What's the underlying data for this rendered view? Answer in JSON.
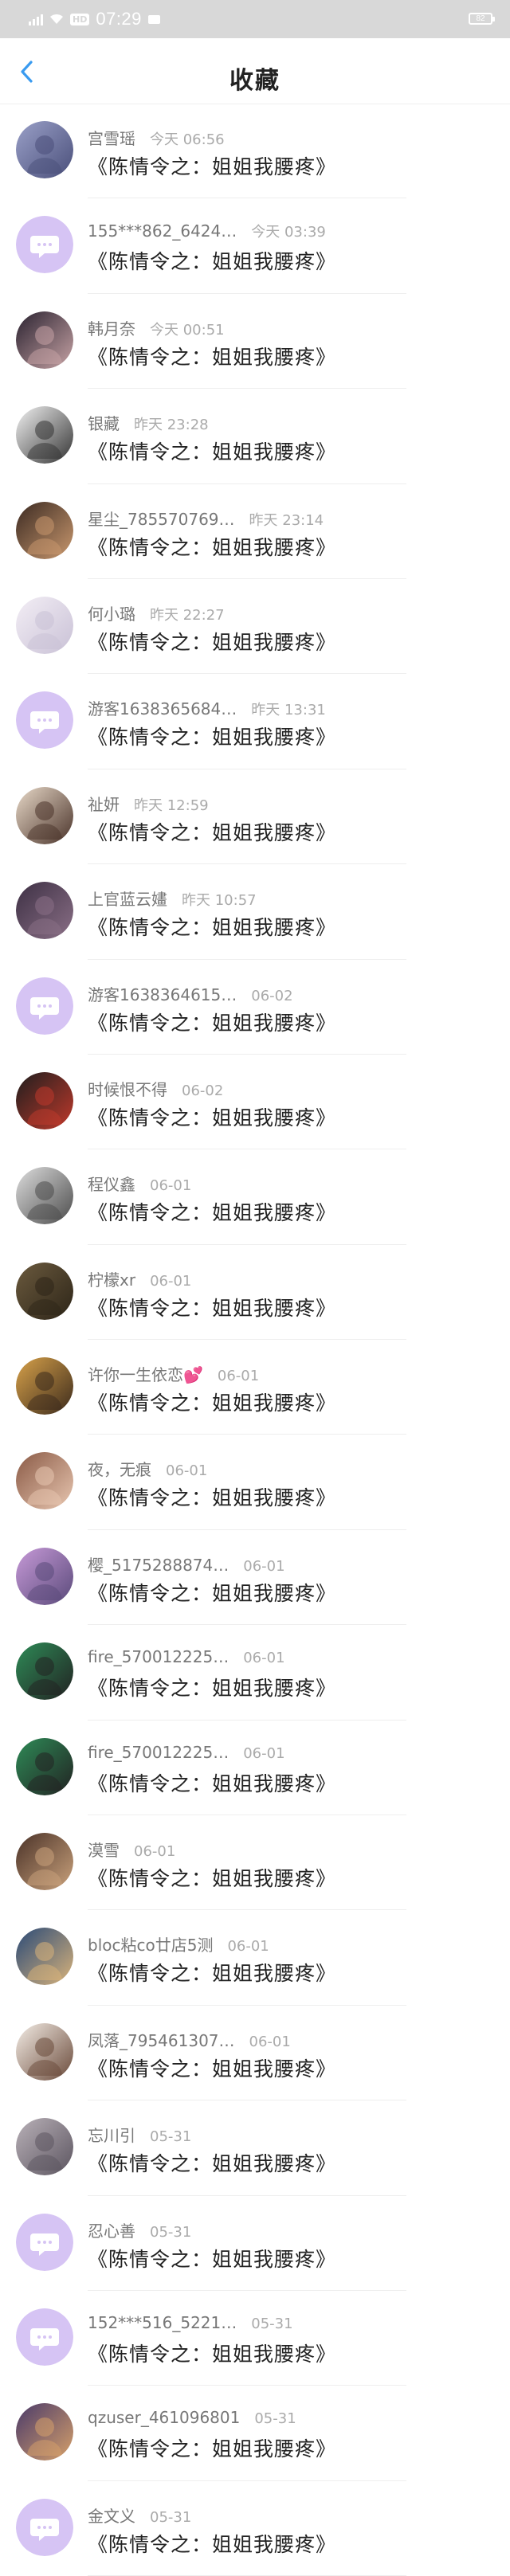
{
  "status_bar": {
    "time": "07:29",
    "network": "HD",
    "battery": "82"
  },
  "header": {
    "title": "收藏",
    "back_icon": "chevron-left-icon"
  },
  "colors": {
    "accent": "#3a9bf0",
    "default_avatar": "#d6c4f4",
    "default_avatar_icon": "#ffffff"
  },
  "items": [
    {
      "user": "宫雪瑶",
      "time": "今天 06:56",
      "content": "《陈情令之：姐姐我腰疼》",
      "avatar": "photo",
      "palette": [
        "#9aa0c8",
        "#4a4f7a"
      ]
    },
    {
      "user": "155***862_6424…",
      "time": "今天 03:39",
      "content": "《陈情令之：姐姐我腰疼》",
      "avatar": "default",
      "palette": [
        "#d6c4f4",
        "#ffffff"
      ]
    },
    {
      "user": "韩月奈",
      "time": "今天 00:51",
      "content": "《陈情令之：姐姐我腰疼》",
      "avatar": "photo",
      "palette": [
        "#2a2230",
        "#c7a3a5"
      ]
    },
    {
      "user": "银藏",
      "time": "昨天 23:28",
      "content": "《陈情令之：姐姐我腰疼》",
      "avatar": "photo",
      "palette": [
        "#f2f2f2",
        "#333333"
      ]
    },
    {
      "user": "星尘_785570769…",
      "time": "昨天 23:14",
      "content": "《陈情令之：姐姐我腰疼》",
      "avatar": "photo",
      "palette": [
        "#3b2a22",
        "#c9986e"
      ]
    },
    {
      "user": "何小璐",
      "time": "昨天 22:27",
      "content": "《陈情令之：姐姐我腰疼》",
      "avatar": "photo",
      "palette": [
        "#f3eef5",
        "#c9c1d6"
      ]
    },
    {
      "user": "游客1638365684…",
      "time": "昨天 13:31",
      "content": "《陈情令之：姐姐我腰疼》",
      "avatar": "default",
      "palette": [
        "#d6c4f4",
        "#ffffff"
      ]
    },
    {
      "user": "祉妍",
      "time": "昨天 12:59",
      "content": "《陈情令之：姐姐我腰疼》",
      "avatar": "photo",
      "palette": [
        "#e8d9c8",
        "#4a332a"
      ]
    },
    {
      "user": "上官蓝云嫿",
      "time": "昨天 10:57",
      "content": "《陈情令之：姐姐我腰疼》",
      "avatar": "photo",
      "palette": [
        "#3d3044",
        "#8a6f86"
      ]
    },
    {
      "user": "游客1638364615…",
      "time": "06-02",
      "content": "《陈情令之：姐姐我腰疼》",
      "avatar": "default",
      "palette": [
        "#d6c4f4",
        "#ffffff"
      ]
    },
    {
      "user": "时候恨不得",
      "time": "06-02",
      "content": "《陈情令之：姐姐我腰疼》",
      "avatar": "photo",
      "palette": [
        "#1e1e1e",
        "#c0392b"
      ]
    },
    {
      "user": "程仪鑫",
      "time": "06-01",
      "content": "《陈情令之：姐姐我腰疼》",
      "avatar": "photo",
      "palette": [
        "#dedede",
        "#4b4b4b"
      ]
    },
    {
      "user": "柠檬xr",
      "time": "06-01",
      "content": "《陈情令之：姐姐我腰疼》",
      "avatar": "photo",
      "palette": [
        "#6b5a3e",
        "#2d2518"
      ]
    },
    {
      "user": "许你一生依恋💕",
      "time": "06-01",
      "content": "《陈情令之：姐姐我腰疼》",
      "avatar": "photo",
      "palette": [
        "#d8a24a",
        "#3b2a1c"
      ]
    },
    {
      "user": "夜，无痕",
      "time": "06-01",
      "content": "《陈情令之：姐姐我腰疼》",
      "avatar": "photo",
      "palette": [
        "#8a5a46",
        "#e8c6b0"
      ]
    },
    {
      "user": "樱_5175288874…",
      "time": "06-01",
      "content": "《陈情令之：姐姐我腰疼》",
      "avatar": "photo",
      "palette": [
        "#c79ad8",
        "#5a4a7a"
      ]
    },
    {
      "user": "fire_570012225…",
      "time": "06-01",
      "content": "《陈情令之：姐姐我腰疼》",
      "avatar": "photo",
      "palette": [
        "#2e8b57",
        "#222222"
      ]
    },
    {
      "user": "fire_570012225…",
      "time": "06-01",
      "content": "《陈情令之：姐姐我腰疼》",
      "avatar": "photo",
      "palette": [
        "#2e8b57",
        "#222222"
      ]
    },
    {
      "user": "漠雪",
      "time": "06-01",
      "content": "《陈情令之：姐姐我腰疼》",
      "avatar": "photo",
      "palette": [
        "#4a3228",
        "#caa27c"
      ]
    },
    {
      "user": "bloc粘co廿店5测",
      "time": "06-01",
      "content": "《陈情令之：姐姐我腰疼》",
      "avatar": "photo",
      "palette": [
        "#2a4a78",
        "#d9b37a"
      ]
    },
    {
      "user": "凤落_795461307…",
      "time": "06-01",
      "content": "《陈情令之：姐姐我腰疼》",
      "avatar": "photo",
      "palette": [
        "#f4ede6",
        "#6a4a3a"
      ]
    },
    {
      "user": "忘川引",
      "time": "05-31",
      "content": "《陈情令之：姐姐我腰疼》",
      "avatar": "photo",
      "palette": [
        "#b9b1b8",
        "#5c5560"
      ]
    },
    {
      "user": "忍心善",
      "time": "05-31",
      "content": "《陈情令之：姐姐我腰疼》",
      "avatar": "default",
      "palette": [
        "#d6c4f4",
        "#ffffff"
      ]
    },
    {
      "user": "152***516_5221…",
      "time": "05-31",
      "content": "《陈情令之：姐姐我腰疼》",
      "avatar": "default",
      "palette": [
        "#d6c4f4",
        "#ffffff"
      ]
    },
    {
      "user": "qzuser_461096801",
      "time": "05-31",
      "content": "《陈情令之：姐姐我腰疼》",
      "avatar": "photo",
      "palette": [
        "#4a3a6a",
        "#d6a06a"
      ]
    },
    {
      "user": "金文义",
      "time": "05-31",
      "content": "《陈情令之：姐姐我腰疼》",
      "avatar": "default",
      "palette": [
        "#d6c4f4",
        "#ffffff"
      ]
    }
  ]
}
